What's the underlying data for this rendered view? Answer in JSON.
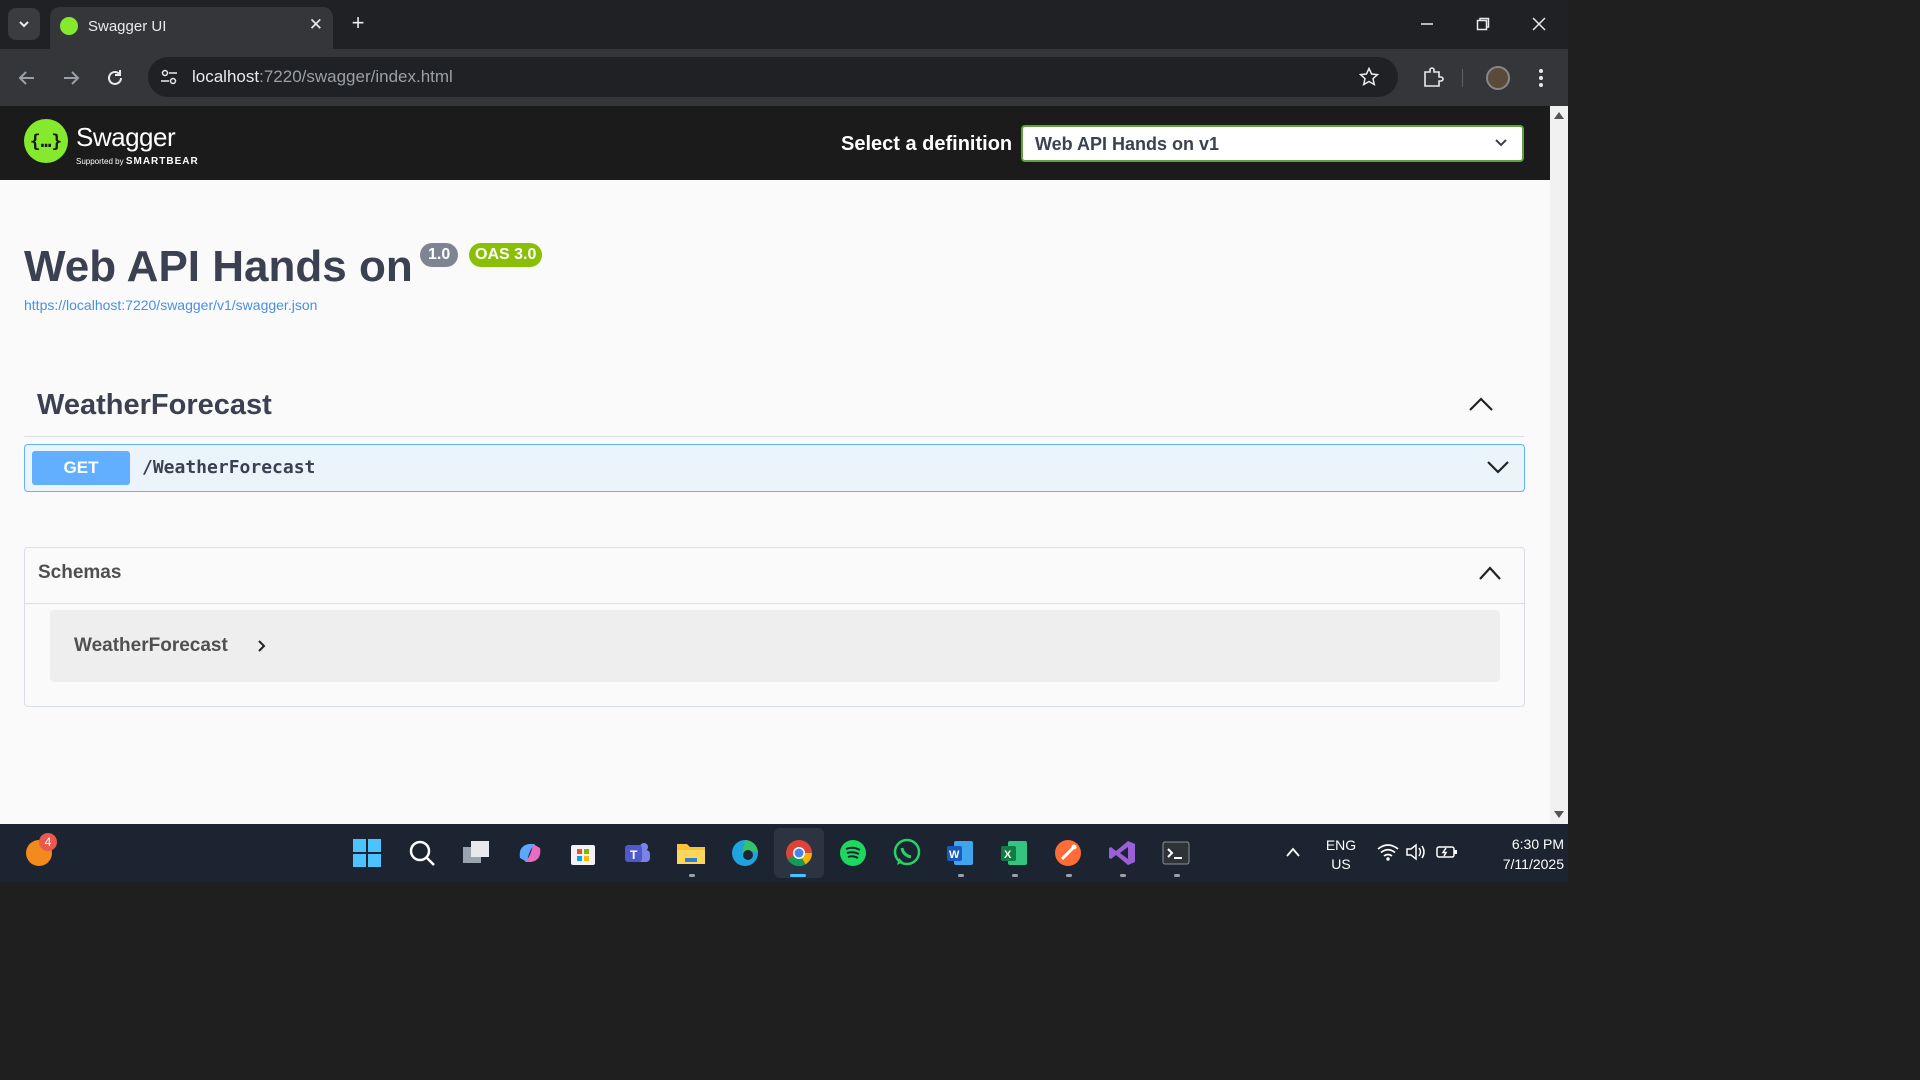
{
  "browser": {
    "tab_title": "Swagger UI",
    "url_host": "localhost",
    "url_rest": ":7220/swagger/index.html"
  },
  "swagger": {
    "logo_word": "Swagger",
    "logo_sub_prefix": "Supported by",
    "logo_sub_brand": "SMARTBEAR",
    "definition_label": "Select a definition",
    "definition_selected": "Web API Hands on v1",
    "info_title": "Web API Hands on",
    "version_badge": "1.0",
    "oas_badge": "OAS 3.0",
    "spec_link": "https://localhost:7220/swagger/v1/swagger.json",
    "tag": {
      "name": "WeatherForecast",
      "operations": [
        {
          "method": "GET",
          "path": "/WeatherForecast"
        }
      ]
    },
    "schemas": {
      "title": "Schemas",
      "items": [
        "WeatherForecast"
      ]
    }
  },
  "colors": {
    "swagger_green": "#85ea2d",
    "get_blue": "#61affe",
    "oas_green": "#89bf04",
    "version_gray": "#7d8492"
  },
  "taskbar": {
    "notification_badge": "4",
    "apps": [
      "start-icon",
      "search-icon",
      "task-view-icon",
      "copilot-icon",
      "store-icon",
      "teams-icon",
      "file-explorer-icon",
      "edge-icon",
      "chrome-icon",
      "spotify-icon",
      "whatsapp-icon",
      "word-icon",
      "excel-icon",
      "postman-icon",
      "visual-studio-icon",
      "terminal-icon"
    ],
    "lang_top": "ENG",
    "lang_bottom": "US",
    "time": "6:30 PM",
    "date": "7/11/2025"
  }
}
